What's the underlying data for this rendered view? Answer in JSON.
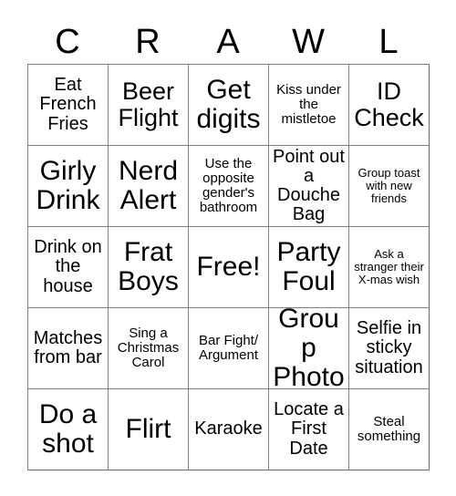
{
  "card": {
    "title_letters": [
      "C",
      "R",
      "A",
      "W",
      "L"
    ],
    "free_space_label": "Free!",
    "border_color": "#808080",
    "text_color": "#000000",
    "background_color": "#ffffff",
    "rows": 5,
    "columns": 5,
    "cells": [
      [
        {
          "text": "Eat French Fries",
          "size": "md"
        },
        {
          "text": "Beer Flight",
          "size": "lg"
        },
        {
          "text": "Get digits",
          "size": "xl"
        },
        {
          "text": "Kiss under the mistletoe",
          "size": "sm"
        },
        {
          "text": "ID Check",
          "size": "lg"
        }
      ],
      [
        {
          "text": "Girly Drink",
          "size": "xl"
        },
        {
          "text": "Nerd Alert",
          "size": "xl"
        },
        {
          "text": "Use the opposite gender's bathroom",
          "size": "sm"
        },
        {
          "text": "Point out a Douche Bag",
          "size": "md"
        },
        {
          "text": "Group toast with new friends",
          "size": "xs"
        }
      ],
      [
        {
          "text": "Drink on the house",
          "size": "md"
        },
        {
          "text": "Frat Boys",
          "size": "xl"
        },
        {
          "text": "Free!",
          "size": "xl"
        },
        {
          "text": "Party Foul",
          "size": "xl"
        },
        {
          "text": "Ask a stranger their X-mas wish",
          "size": "xs"
        }
      ],
      [
        {
          "text": "Matches from bar",
          "size": "md"
        },
        {
          "text": "Sing a Christmas Carol",
          "size": "sm"
        },
        {
          "text": "Bar Fight/ Argument",
          "size": "sm"
        },
        {
          "text": "Group Photo",
          "size": "xl"
        },
        {
          "text": "Selfie in sticky situation",
          "size": "md"
        }
      ],
      [
        {
          "text": "Do a shot",
          "size": "xl"
        },
        {
          "text": "Flirt",
          "size": "xl"
        },
        {
          "text": "Karaoke",
          "size": "md"
        },
        {
          "text": "Locate a First Date",
          "size": "md"
        },
        {
          "text": "Steal something",
          "size": "sm"
        }
      ]
    ]
  }
}
